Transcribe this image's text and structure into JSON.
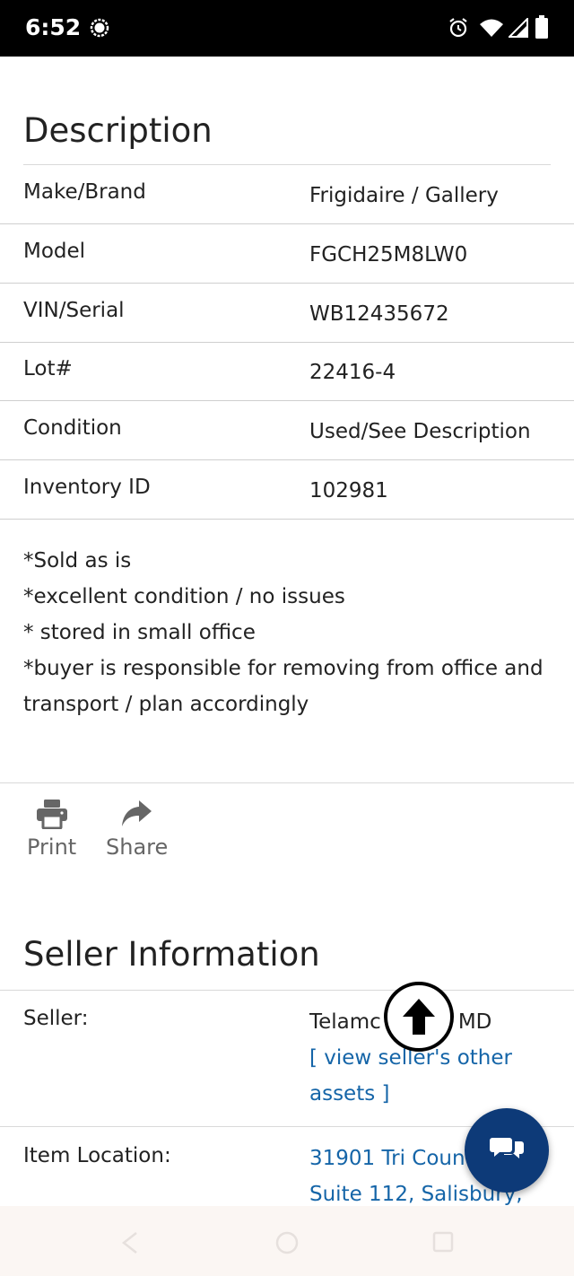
{
  "status_bar": {
    "time": "6:52",
    "icons": [
      "app-notification-icon",
      "alarm-icon",
      "wifi-icon",
      "signal-icon",
      "battery-icon"
    ]
  },
  "description": {
    "title": "Description",
    "rows": [
      {
        "label": "Make/Brand",
        "value": "Frigidaire / Gallery"
      },
      {
        "label": "Model",
        "value": "FGCH25M8LW0"
      },
      {
        "label": "VIN/Serial",
        "value": "WB12435672"
      },
      {
        "label": "Lot#",
        "value": "22416-4"
      },
      {
        "label": "Condition",
        "value": "Used/See Description"
      },
      {
        "label": "Inventory ID",
        "value": "102981"
      }
    ],
    "notes": [
      "*Sold as is",
      "*excellent condition / no issues",
      "* stored in small office",
      "*buyer is responsible for removing from office and",
      "transport / plan accordingly"
    ]
  },
  "actions": {
    "print_label": "Print",
    "share_label": "Share"
  },
  "seller_info": {
    "title": "Seller Information",
    "seller_label": "Seller:",
    "seller_name_start": "Telamc",
    "seller_name_end": "MD",
    "seller_link_line1": "[ view seller's other",
    "seller_link_line2": "assets ]",
    "location_label": "Item Location:",
    "location_line1": "31901 Tri Coun",
    "location_line2": "Suite 112, Salisbury,"
  },
  "colors": {
    "link": "#1565a8",
    "chat_button": "#0d3a78",
    "text": "#222222",
    "action_gray": "#666666"
  }
}
